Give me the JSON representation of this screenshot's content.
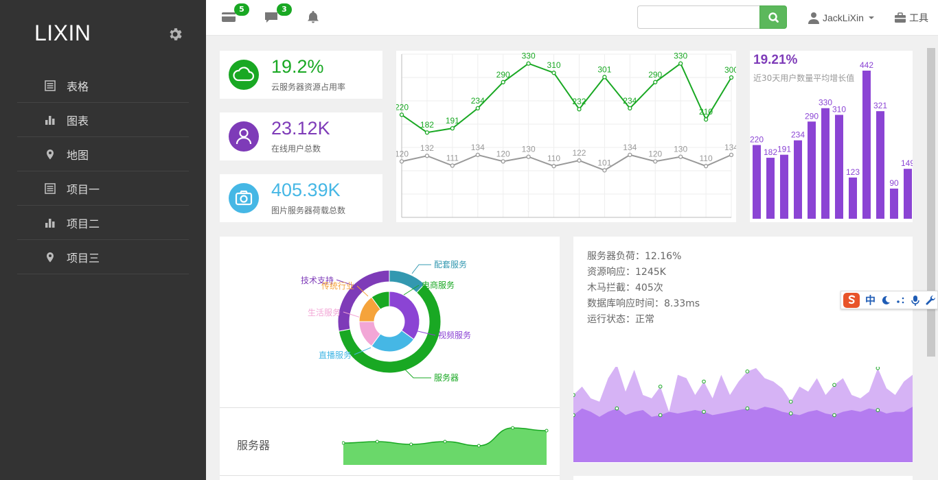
{
  "sidebar": {
    "logo": "LIXIN",
    "items": [
      {
        "label": "表格",
        "icon": "table-icon"
      },
      {
        "label": "图表",
        "icon": "bar-chart-icon"
      },
      {
        "label": "地图",
        "icon": "map-marker-icon"
      },
      {
        "label": "项目一",
        "icon": "table-icon"
      },
      {
        "label": "项目二",
        "icon": "bar-chart-icon"
      },
      {
        "label": "项目三",
        "icon": "map-marker-icon"
      }
    ]
  },
  "topbar": {
    "card_badge": "5",
    "message_badge": "3",
    "search": {
      "value": "",
      "placeholder": ""
    },
    "username": "JackLiXin",
    "tools": "工具"
  },
  "stats": [
    {
      "value": "19.2%",
      "label": "云服务器资源占用率",
      "color": "#19a823",
      "icon": "cloud-icon"
    },
    {
      "value": "23.12K",
      "label": "在线用户总数",
      "color": "#7e3bb8",
      "icon": "user-icon"
    },
    {
      "value": "405.39K",
      "label": "图片服务器荷载总数",
      "color": "#45b7e5",
      "icon": "camera-icon"
    }
  ],
  "growth": {
    "value": "19.21%",
    "label": "近30天用户数量平均增长值"
  },
  "info": {
    "load": "服务器负荷：12.16%",
    "response": "资源响应：1245K",
    "trojan": "木马拦截：405次",
    "db": "数据库响应时间：8.33ms",
    "status": "运行状态：正常"
  },
  "server_label": "服务器",
  "ime": {
    "lang": "中"
  },
  "chart_data": [
    {
      "type": "line",
      "series": [
        {
          "color": "#19a823",
          "values": [
            220,
            182,
            191,
            234,
            290,
            330,
            310,
            232,
            301,
            234,
            290,
            330,
            210,
            300
          ]
        },
        {
          "color": "#999999",
          "values": [
            120,
            132,
            111,
            134,
            120,
            130,
            110,
            122,
            101,
            134,
            120,
            130,
            110,
            134
          ]
        }
      ],
      "grid": true
    },
    {
      "type": "bar",
      "color": "#8b44d4",
      "values": [
        220,
        182,
        191,
        234,
        290,
        330,
        310,
        123,
        442,
        321,
        90,
        149
      ]
    },
    {
      "type": "pie",
      "inner": [
        {
          "name": "视频服务",
          "value": 35,
          "color": "#8b44d4"
        },
        {
          "name": "直播服务",
          "value": 25,
          "color": "#45b7e5"
        },
        {
          "name": "生活服务",
          "value": 15,
          "color": "#f2a6d6"
        },
        {
          "name": "传统行业",
          "value": 15,
          "color": "#f5a33b"
        },
        {
          "name": "电商服务",
          "value": 10,
          "color": "#19a823"
        }
      ],
      "outer": [
        {
          "name": "配套服务",
          "value": 12,
          "color": "#3398b0"
        },
        {
          "name": "服务器",
          "value": 60,
          "color": "#19a823"
        },
        {
          "name": "技术支持",
          "value": 28,
          "color": "#7e3bb8"
        }
      ]
    },
    {
      "type": "area",
      "color": "#3fc43f",
      "values": [
        11,
        12,
        10,
        12,
        9,
        22,
        20
      ]
    },
    {
      "type": "area",
      "series": [
        {
          "color": "#d6b3f5",
          "values": [
            40,
            45,
            38,
            36,
            50,
            58,
            42,
            55,
            40,
            38,
            45,
            30,
            52,
            50,
            40,
            48,
            38,
            52,
            40,
            48,
            54,
            56,
            50,
            48,
            44,
            36,
            45,
            42,
            50,
            40,
            46,
            50,
            40,
            38,
            42,
            56,
            44,
            40,
            48,
            52
          ]
        },
        {
          "color": "#b47cf0",
          "values": [
            28,
            32,
            30,
            27,
            30,
            32,
            28,
            30,
            31,
            27,
            28,
            30,
            29,
            30,
            31,
            30,
            28,
            29,
            30,
            31,
            32,
            31,
            33,
            32,
            30,
            29,
            28,
            30,
            31,
            29,
            28,
            30,
            31,
            30,
            32,
            31,
            29,
            30,
            30,
            33
          ]
        }
      ]
    }
  ]
}
